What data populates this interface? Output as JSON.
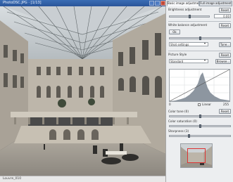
{
  "window": {
    "title": "PhotoDSC.JPG ·  [1/13]",
    "status": "Louvre_010"
  },
  "panel": {
    "tabs": [
      "Basic image adjustment",
      "Full image adjustment"
    ],
    "brightness": {
      "label": "Brightness adjustment",
      "reset": "Reset",
      "value": "0.00"
    },
    "white_balance": {
      "label": "White balance adjustment",
      "ok": "Ok",
      "reset": "Reset"
    },
    "shot_settings": {
      "value": "Shot settings",
      "tune": "Tune..."
    },
    "picture_style": {
      "label": "Picture Style",
      "reset": "Reset",
      "value": "Standard",
      "browse": "Browse..."
    },
    "histogram": {
      "left_value": "0",
      "linear_label": "Linear",
      "right_value": "255"
    },
    "contrast": {
      "label": "Color tone (0)",
      "reset": "Reset"
    },
    "saturation": {
      "label": "Color saturation (0)"
    },
    "sharpness": {
      "label": "Sharpness (3)"
    }
  },
  "colors": {
    "titlebar": "#2f5fa8",
    "panel": "#eceef0",
    "accent": "#3b6db4"
  }
}
